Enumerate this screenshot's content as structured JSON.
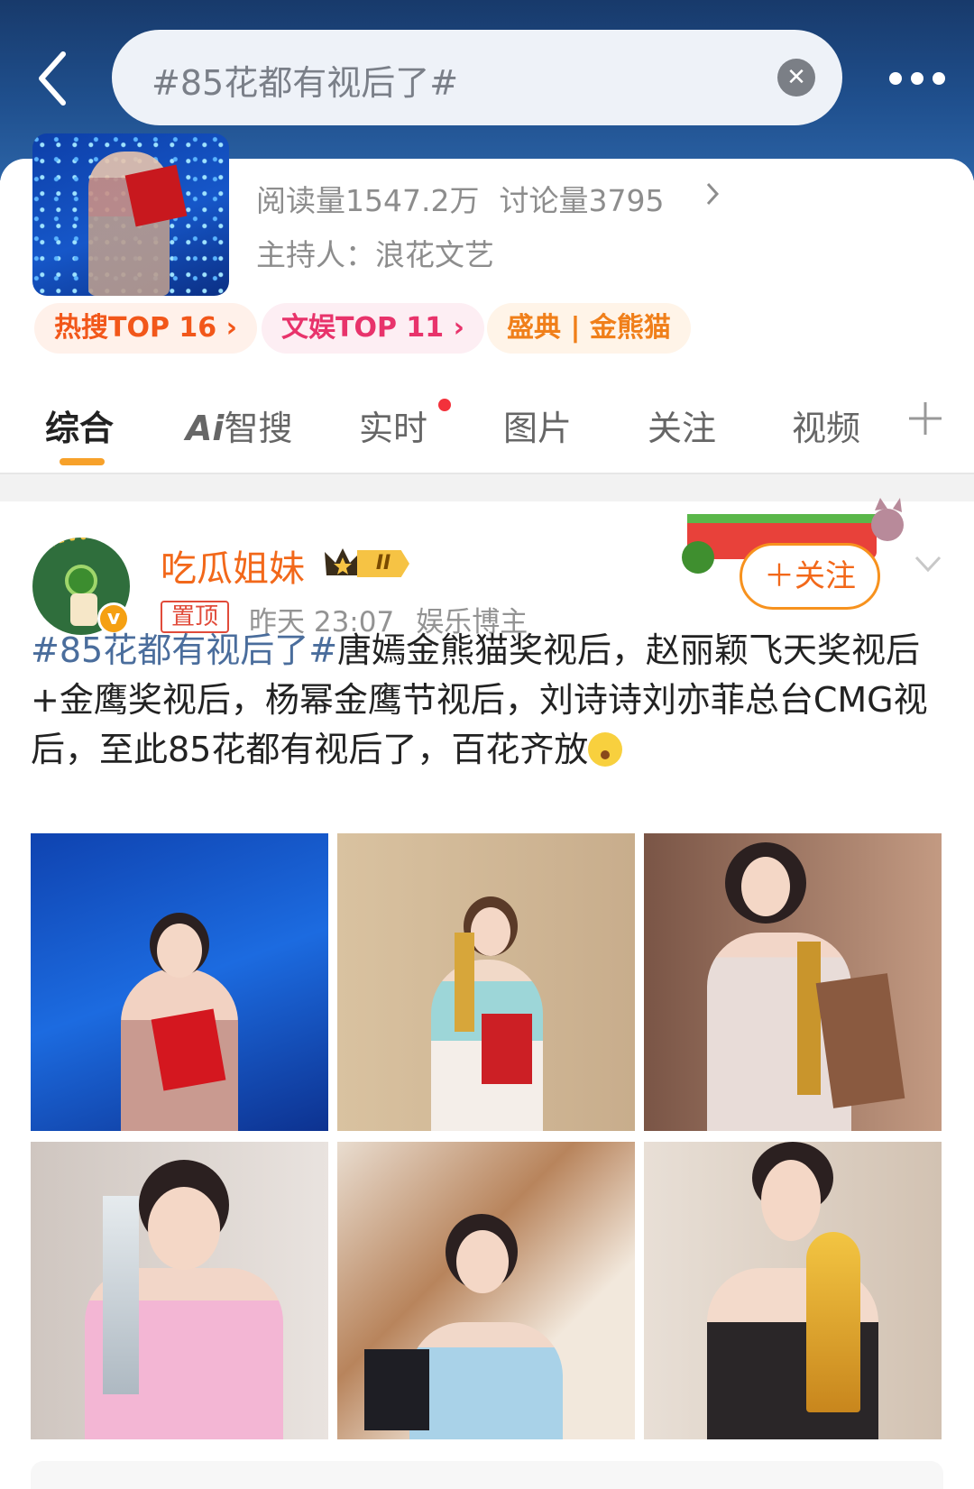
{
  "search": {
    "query": "#85花都有视后了#"
  },
  "topic": {
    "reads": "阅读量1547.2万",
    "discussions": "讨论量3795",
    "host": "主持人：浪花文艺",
    "badges": {
      "hot": "热搜TOP 16 ›",
      "ent": "文娱TOP 11 ›",
      "event": "盛典 | 金熊猫"
    }
  },
  "tabs": {
    "comprehensive": "综合",
    "ai_prefix": "Ai",
    "ai_suffix": "智搜",
    "realtime": "实时",
    "images": "图片",
    "following": "关注",
    "videos": "视频"
  },
  "post": {
    "author": "吃瓜姐妹",
    "level": "II",
    "pin": "置顶",
    "time": "昨天 23:07",
    "category": "娱乐博主",
    "follow": "＋关注",
    "topic_tag": "#85花都有视后了#",
    "body": "唐嫣金熊猫奖视后，赵丽颖飞天奖视后+金鹰奖视后，杨幂金鹰节视后，刘诗诗刘亦菲总台CMG视后，至此85花都有视后了，百花齐放"
  },
  "icons": [
    "back-arrow-icon",
    "clear-icon",
    "more-dots-icon",
    "chevron-right-icon",
    "plus-icon",
    "crown-icon",
    "verified-v-icon",
    "chevron-down-icon",
    "surprised-emoji-icon"
  ],
  "colors": {
    "header": "#1f4f8d",
    "accent_orange": "#f2681a",
    "topic_link": "#4a6d9c",
    "hot": "#f2571a",
    "ent": "#e8336b"
  }
}
